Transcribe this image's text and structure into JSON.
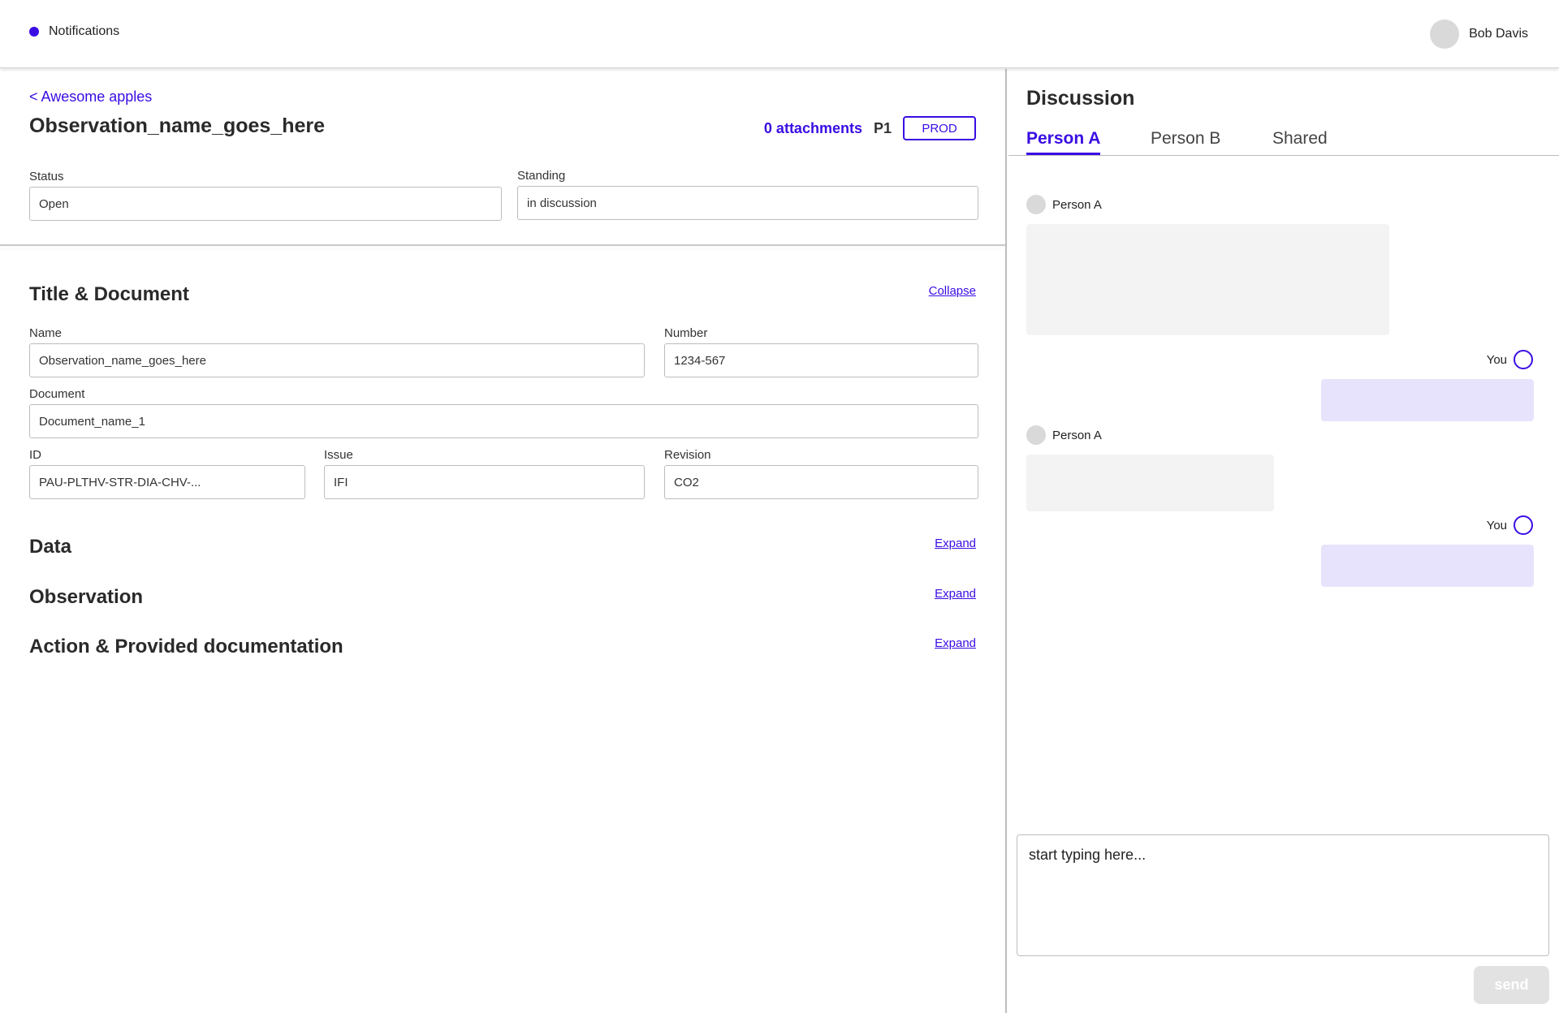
{
  "topbar": {
    "notifications_label": "Notifications",
    "user_name": "Bob Davis",
    "accent": "#3a0de3"
  },
  "observation": {
    "back_label": "< Awesome apples",
    "title": "Observation_name_goes_here",
    "attachments_label": "0 attachments",
    "priority": "P1",
    "environment": "PROD",
    "status": {
      "label": "Status",
      "value": "Open"
    },
    "standing": {
      "label": "Standing",
      "value": "in discussion"
    }
  },
  "sections": {
    "title_document": {
      "title": "Title & Document",
      "toggle_label": "Collapse",
      "fields": {
        "name": {
          "label": "Name",
          "value": "Observation_name_goes_here"
        },
        "number": {
          "label": "Number",
          "value": "1234-567"
        },
        "document": {
          "label": "Document",
          "value": "Document_name_1"
        },
        "id": {
          "label": "ID",
          "value": "PAU-PLTHV-STR-DIA-CHV-..."
        },
        "issue": {
          "label": "Issue",
          "value": "IFI"
        },
        "revision": {
          "label": "Revision",
          "value": "CO2"
        }
      }
    },
    "data": {
      "title": "Data",
      "toggle_label": "Expand"
    },
    "observation": {
      "title": "Observation",
      "toggle_label": "Expand"
    },
    "action": {
      "title": "Action &  Provided documentation",
      "toggle_label": "Expand"
    }
  },
  "discussion": {
    "title": "Discussion",
    "tabs": [
      {
        "label": "Person A",
        "active": true
      },
      {
        "label": "Person B",
        "active": false
      },
      {
        "label": "Shared",
        "active": false
      }
    ],
    "messages": [
      {
        "author": "Person A",
        "direction": "incoming"
      },
      {
        "author": "You",
        "direction": "outgoing"
      },
      {
        "author": "Person A",
        "direction": "incoming"
      },
      {
        "author": "You",
        "direction": "outgoing"
      }
    ],
    "composer_placeholder": "start typing here...",
    "send_label": "send"
  }
}
